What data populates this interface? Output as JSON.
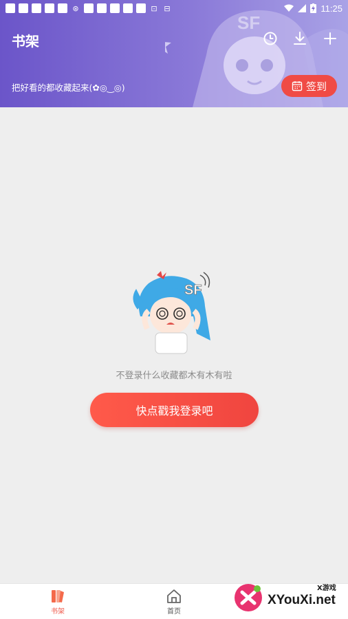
{
  "status_bar": {
    "time": "11:25"
  },
  "header": {
    "title": "书架",
    "subtitle": "把好看的都收藏起来(✿◎‿◎)",
    "signin_label": "签到",
    "icons": [
      "clock-icon",
      "download-icon",
      "plus-icon"
    ]
  },
  "empty_state": {
    "message": "不登录什么收藏都木有木有啦",
    "login_button": "快点戳我登录吧"
  },
  "bottom_nav": {
    "items": [
      {
        "label": "书架",
        "icon": "bookshelf-icon",
        "active": true
      },
      {
        "label": "首页",
        "icon": "home-icon",
        "active": false
      }
    ]
  },
  "watermark": {
    "brand": "XYouXi.net",
    "small": "X游戏"
  },
  "colors": {
    "header_start": "#6b55c9",
    "accent": "#f04b45",
    "background": "#eeeeee"
  }
}
